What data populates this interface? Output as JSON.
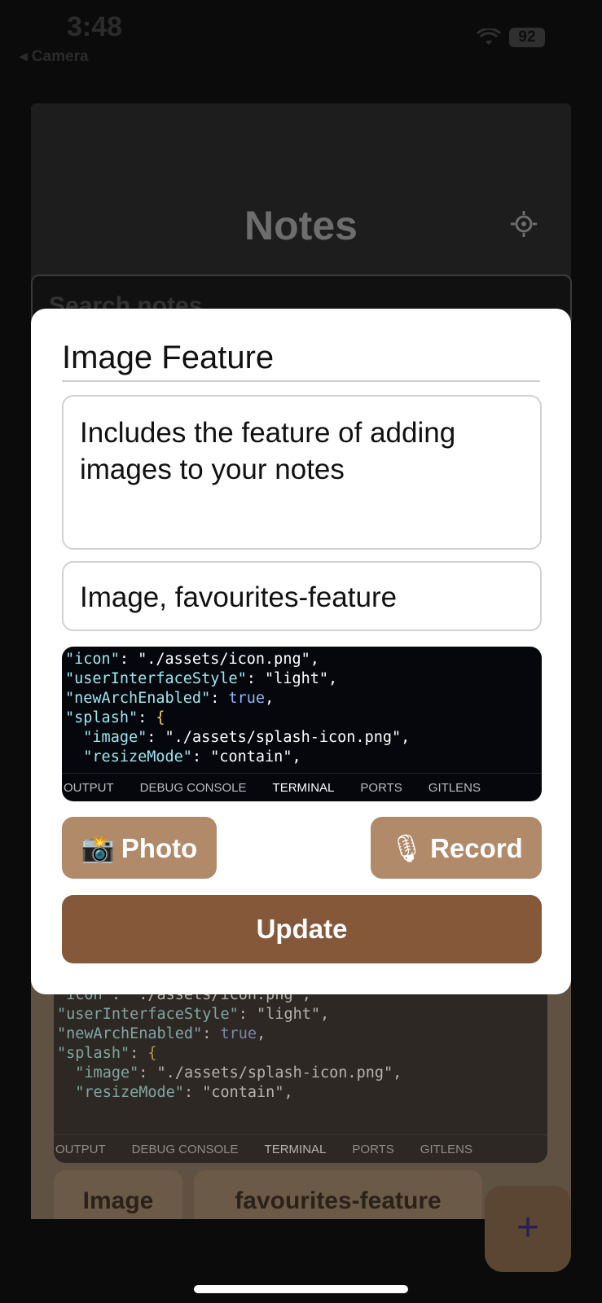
{
  "status": {
    "time": "3:48",
    "back_label": "◂ Camera",
    "battery": "92"
  },
  "background": {
    "title": "Notes",
    "search_placeholder": "Search notes",
    "tags": [
      "Image",
      "favourites-feature"
    ],
    "fab": "+"
  },
  "code_preview": {
    "tabs": [
      "OUTPUT",
      "DEBUG CONSOLE",
      "TERMINAL",
      "PORTS",
      "GITLENS"
    ]
  },
  "modal": {
    "title": "Image Feature",
    "description": "Includes the feature of adding images to your notes",
    "tags_value": "Image, favourites-feature",
    "photo_label": "Photo",
    "record_label": "Record",
    "update_label": "Update"
  },
  "icons": {
    "photo": "camera-flash-icon",
    "record": "microphone-icon",
    "settings": "gear-icon",
    "wifi": "wifi-icon"
  },
  "colors": {
    "button": "#b08a69",
    "update": "#85583a",
    "chip": "#6b5a47"
  }
}
